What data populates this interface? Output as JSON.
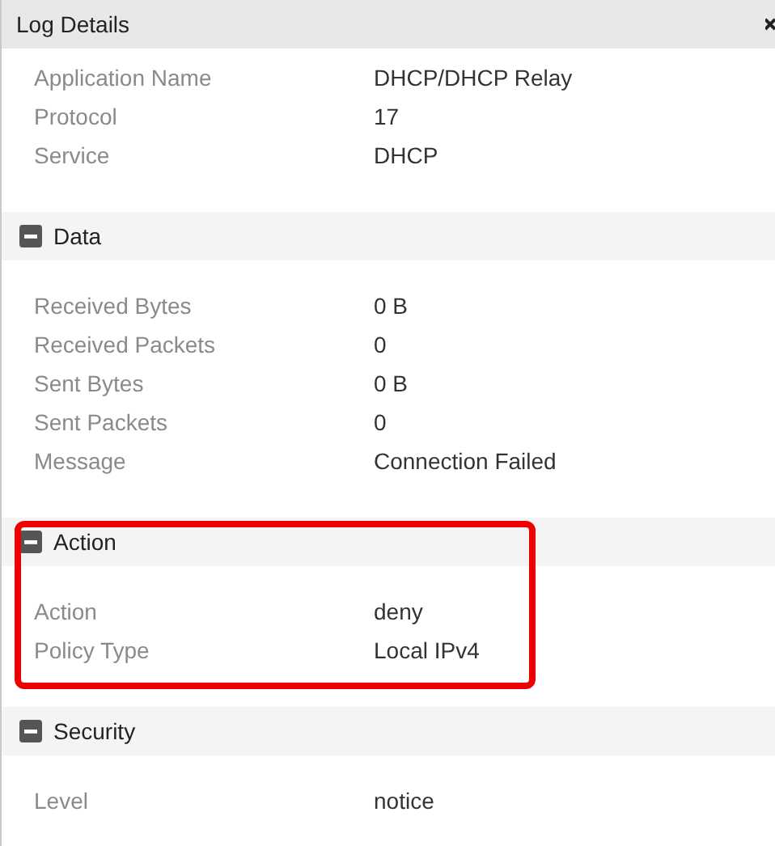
{
  "title": "Log Details",
  "sections": [
    {
      "rows": [
        {
          "label": "Application Name",
          "value": "DHCP/DHCP Relay"
        },
        {
          "label": "Protocol",
          "value": "17"
        },
        {
          "label": "Service",
          "value": "DHCP"
        }
      ]
    },
    {
      "title": "Data",
      "expanded": true,
      "rows": [
        {
          "label": "Received Bytes",
          "value": "0 B"
        },
        {
          "label": "Received Packets",
          "value": "0"
        },
        {
          "label": "Sent Bytes",
          "value": "0 B"
        },
        {
          "label": "Sent Packets",
          "value": "0"
        },
        {
          "label": "Message",
          "value": "Connection Failed"
        }
      ]
    },
    {
      "title": "Action",
      "expanded": true,
      "highlighted": true,
      "rows": [
        {
          "label": "Action",
          "value": "deny"
        },
        {
          "label": "Policy Type",
          "value": "Local IPv4"
        }
      ]
    },
    {
      "title": "Security",
      "expanded": true,
      "rows": [
        {
          "label": "Level",
          "value": "notice"
        }
      ]
    }
  ]
}
